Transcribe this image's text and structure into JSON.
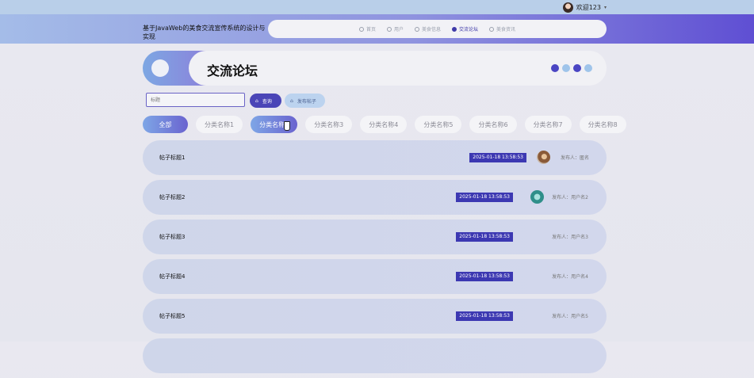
{
  "topbar": {
    "welcome": "欢迎123",
    "caret": "▾"
  },
  "header": {
    "site_title": "基于JavaWeb的美食交流宣传系统的设计与实现",
    "nav": [
      {
        "label": "首页",
        "active": false
      },
      {
        "label": "用户",
        "active": false
      },
      {
        "label": "美食信息",
        "active": false
      },
      {
        "label": "交流论坛",
        "active": true
      },
      {
        "label": "美食资讯",
        "active": false
      }
    ]
  },
  "banner": {
    "title": "交流论坛",
    "dot_colors": [
      "#4a45c3",
      "#9fc4ea",
      "#4a45c3",
      "#9fc4ea"
    ]
  },
  "search": {
    "placeholder": "标题",
    "search_label": "查询",
    "post_label": "发布帖子"
  },
  "categories": {
    "all_label": "全部",
    "items": [
      "分类名称1",
      "分类名称2",
      "分类名称3",
      "分类名称4",
      "分类名称5",
      "分类名称6",
      "分类名称7",
      "分类名称8"
    ]
  },
  "posts": [
    {
      "title": "帖子标题1",
      "date": "2025-01-18 13:58:53",
      "author": "发布人：匿名",
      "avatar": "photo-brown"
    },
    {
      "title": "帖子标题2",
      "date": "2025-01-18 13:58:53",
      "author": "发布人：用户名2",
      "avatar": "photo-teal"
    },
    {
      "title": "帖子标题3",
      "date": "2025-01-18 13:58:53",
      "author": "发布人：用户名3",
      "avatar": ""
    },
    {
      "title": "帖子标题4",
      "date": "2025-01-18 13:58:53",
      "author": "发布人：用户名4",
      "avatar": ""
    },
    {
      "title": "帖子标题5",
      "date": "2025-01-18 13:58:53",
      "author": "发布人：用户名5",
      "avatar": ""
    }
  ]
}
